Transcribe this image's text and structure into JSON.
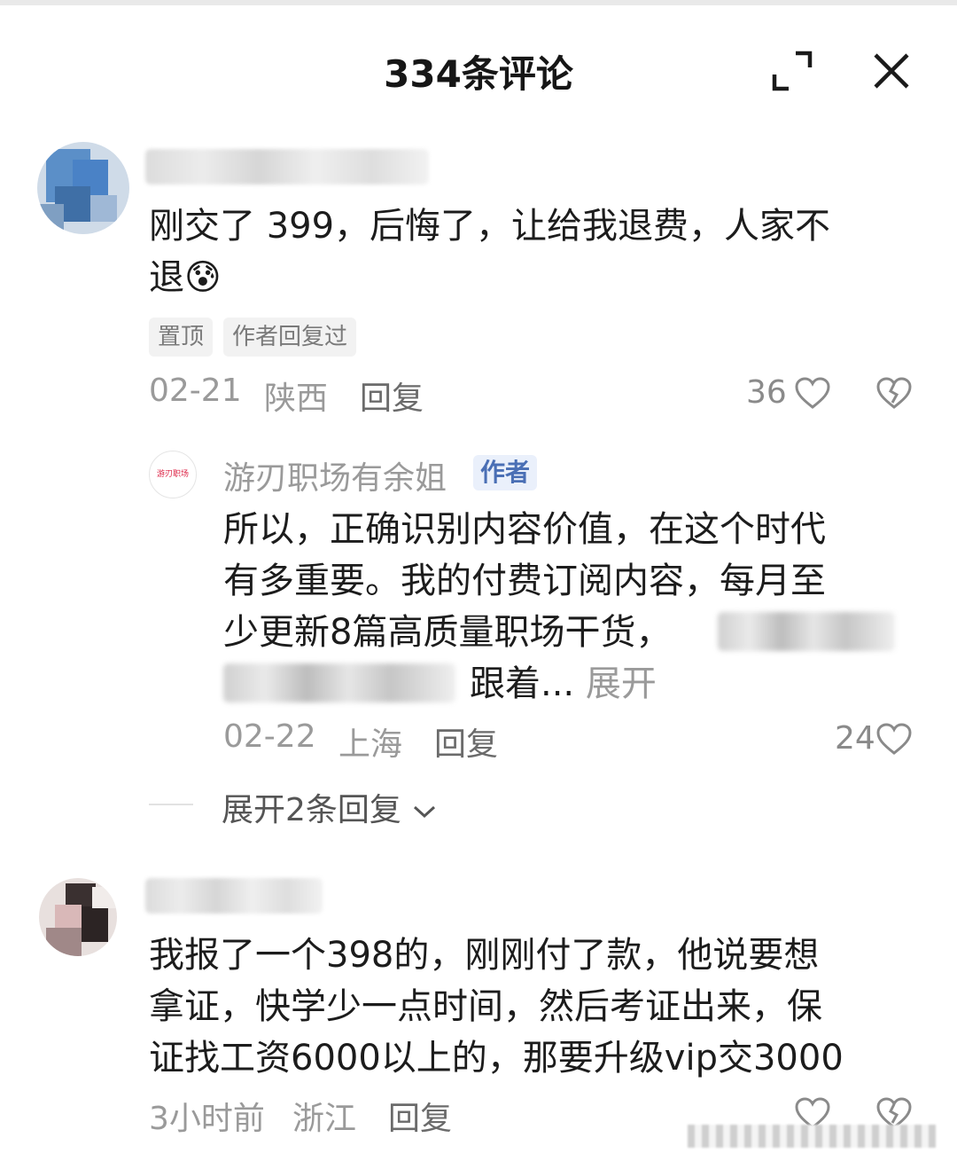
{
  "header": {
    "title": "334条评论"
  },
  "comments": [
    {
      "text_line1": "刚交了 399，后悔了，让给我退费，人家不",
      "text_line2": "退",
      "emoji": "😰",
      "tags": [
        "置顶",
        "作者回复过"
      ],
      "date": "02-21",
      "location": "陕西",
      "reply_label": "回复",
      "likes": "36",
      "reply": {
        "author": "游刃职场有余姐",
        "badge": "作者",
        "avatar_text": "游刃职场",
        "line1": "所以，正确识别内容价值，在这个时代",
        "line2": "有多重要。我的付费订阅内容，每月至",
        "line3": "少更新8篇高质量职场干货，",
        "line4_tail": "跟着...",
        "expand_label": "展开",
        "date": "02-22",
        "location": "上海",
        "reply_label": "回复",
        "likes": "24"
      },
      "more_replies": "展开2条回复"
    },
    {
      "text_line1": "我报了一个398的，刚刚付了款，他说要想",
      "text_line2": "拿证，快学少一点时间，然后考证出来，保",
      "text_line3": "证找工资6000以上的，那要升级vip交3000",
      "date": "3小时前",
      "location": "浙江",
      "reply_label": "回复"
    }
  ],
  "colors": {
    "author_badge_bg": "#eaf0fb",
    "author_badge_text": "#4a6fb5",
    "meta_gray": "#9a9a9a"
  },
  "icons": [
    "expand-icon",
    "close-icon",
    "heart-icon",
    "broken-heart-icon",
    "chevron-down-icon"
  ]
}
